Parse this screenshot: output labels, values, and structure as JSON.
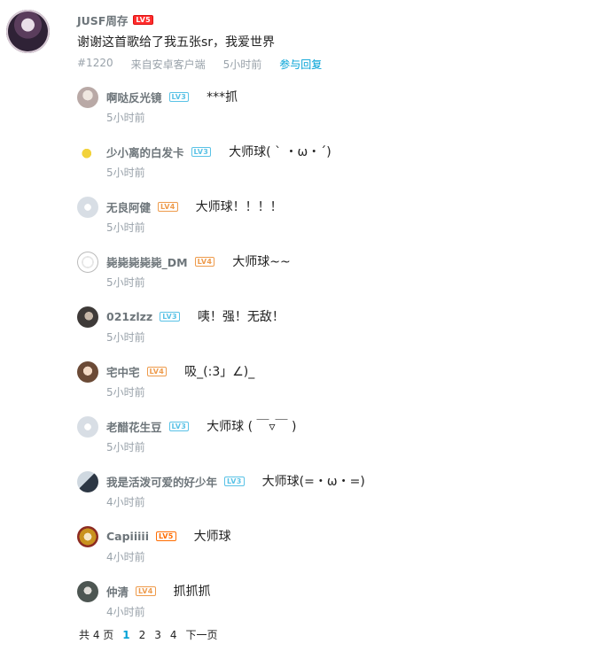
{
  "main": {
    "username": "JUSF周存",
    "level": "LV5",
    "text": "谢谢这首歌给了我五张sr，我爱世界",
    "floor": "#1220",
    "client": "来自安卓客户端",
    "time": "5小时前",
    "reply_label": "参与回复"
  },
  "replies": [
    {
      "name": "啊哒反光镜",
      "level": "LV3",
      "text": "***抓",
      "time": "5小时前"
    },
    {
      "name": "少小离的白发卡",
      "level": "LV3",
      "text": "大师球( ` ・ω・´)",
      "time": "5小时前"
    },
    {
      "name": "无良阿健",
      "level": "LV4",
      "text": "大师球！！！！",
      "time": "5小时前"
    },
    {
      "name": "毙毙毙毙毙_DM",
      "level": "LV4",
      "text": "大师球~~",
      "time": "5小时前"
    },
    {
      "name": "021zlzz",
      "level": "LV3",
      "text": "咦！强！无敌！",
      "time": "5小时前"
    },
    {
      "name": "宅中宅",
      "level": "LV4",
      "text": "吸_(:3」∠)_",
      "time": "5小时前"
    },
    {
      "name": "老醋花生豆",
      "level": "LV3",
      "text": "大师球 ( ￣▿￣ )",
      "time": "5小时前"
    },
    {
      "name": "我是活泼可爱的好少年",
      "level": "LV3",
      "text": "大师球(=・ω・=)",
      "time": "4小时前"
    },
    {
      "name": "Capiiiii",
      "level": "LV5",
      "text": "大师球",
      "time": "4小时前"
    },
    {
      "name": "仲清",
      "level": "LV4",
      "text": "抓抓抓",
      "time": "4小时前"
    }
  ],
  "pager": {
    "total": "共 4 页",
    "pages": [
      "1",
      "2",
      "3",
      "4"
    ],
    "next": "下一页"
  },
  "colors": {
    "link": "#00a1d6",
    "meta": "#99a2aa",
    "name": "#6d757a",
    "lv3": "#59c2e6",
    "lv4": "#ee9b4c",
    "lv5": "#ff6c00"
  }
}
